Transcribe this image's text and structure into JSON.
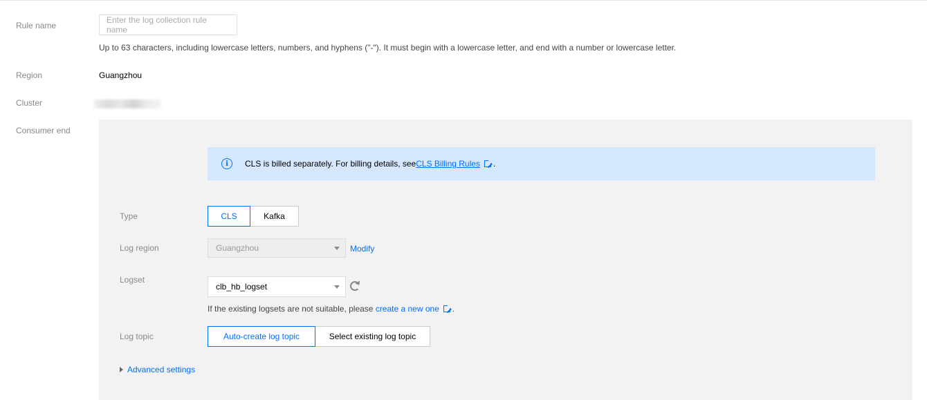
{
  "form": {
    "rule_name": {
      "label": "Rule name",
      "placeholder": "Enter the log collection rule name",
      "hint": "Up to 63 characters, including lowercase letters, numbers, and hyphens (\"-\"). It must begin with a lowercase letter, and end with a number or lowercase letter."
    },
    "region": {
      "label": "Region",
      "value": "Guangzhou"
    },
    "cluster": {
      "label": "Cluster"
    },
    "consumer_end": {
      "label": "Consumer end"
    }
  },
  "alert": {
    "text": "CLS is billed separately. For billing details, see ",
    "link": "CLS Billing Rules",
    "suffix": "."
  },
  "consumer": {
    "type": {
      "label": "Type",
      "options": [
        "CLS",
        "Kafka"
      ],
      "selected": "CLS"
    },
    "log_region": {
      "label": "Log region",
      "value": "Guangzhou",
      "modify": "Modify"
    },
    "logset": {
      "label": "Logset",
      "value": "clb_hb_logset",
      "hint": "If the existing logsets are not suitable, please ",
      "hint_link": "create a new one",
      "hint_suffix": "."
    },
    "log_topic": {
      "label": "Log topic",
      "options": [
        "Auto-create log topic",
        "Select existing log topic"
      ],
      "selected": "Auto-create log topic"
    },
    "advanced": "Advanced settings"
  },
  "colors": {
    "accent": "#006eff",
    "alert_bg": "#d5e7fd",
    "panel_bg": "#f2f2f2"
  }
}
